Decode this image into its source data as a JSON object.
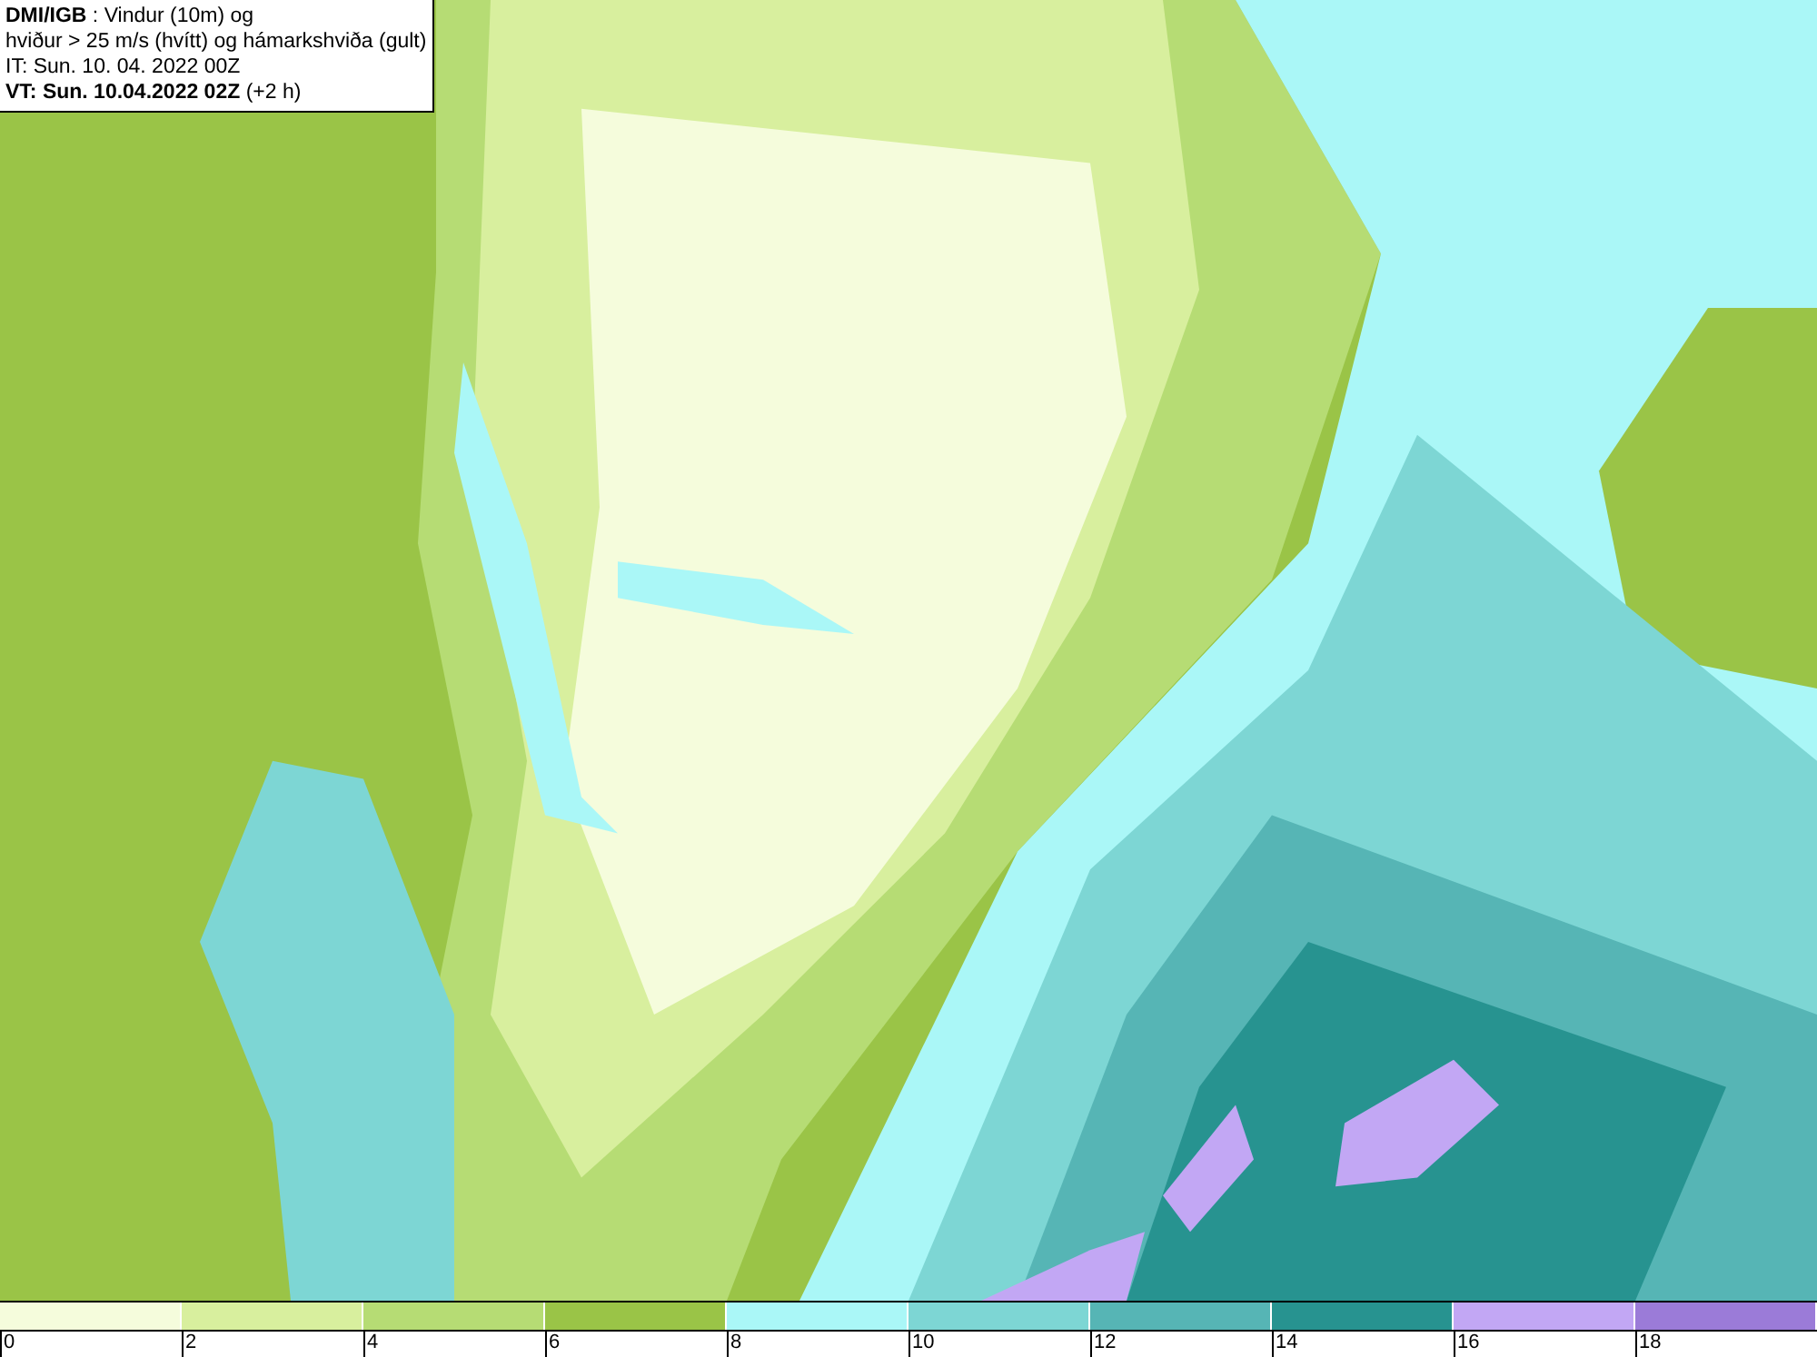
{
  "info_box": {
    "lines": [
      "**DMI/IGB** : Vindur (10m) og",
      "hviður > 25 m/s (hvítt) og hámarkshviða (gult)",
      "IT: Sun. 10. 04. 2022 00Z",
      "**VT: Sun. 10.04.2022 02Z** (+2 h)"
    ]
  },
  "legend": {
    "bins": [
      {
        "color": "#f5fcdc"
      },
      {
        "color": "#d8ef9e"
      },
      {
        "color": "#b6dc74"
      },
      {
        "color": "#9ac447"
      },
      {
        "color": "#aaf7f7"
      },
      {
        "color": "#7dd6d4"
      },
      {
        "color": "#56b5b5"
      },
      {
        "color": "#279390"
      },
      {
        "color": "#c2a7f4"
      },
      {
        "color": "#9b7bd8"
      }
    ],
    "ticks": [
      "0",
      "2",
      "4",
      "6",
      "8",
      "10",
      "12",
      "14",
      "16",
      "18"
    ]
  }
}
